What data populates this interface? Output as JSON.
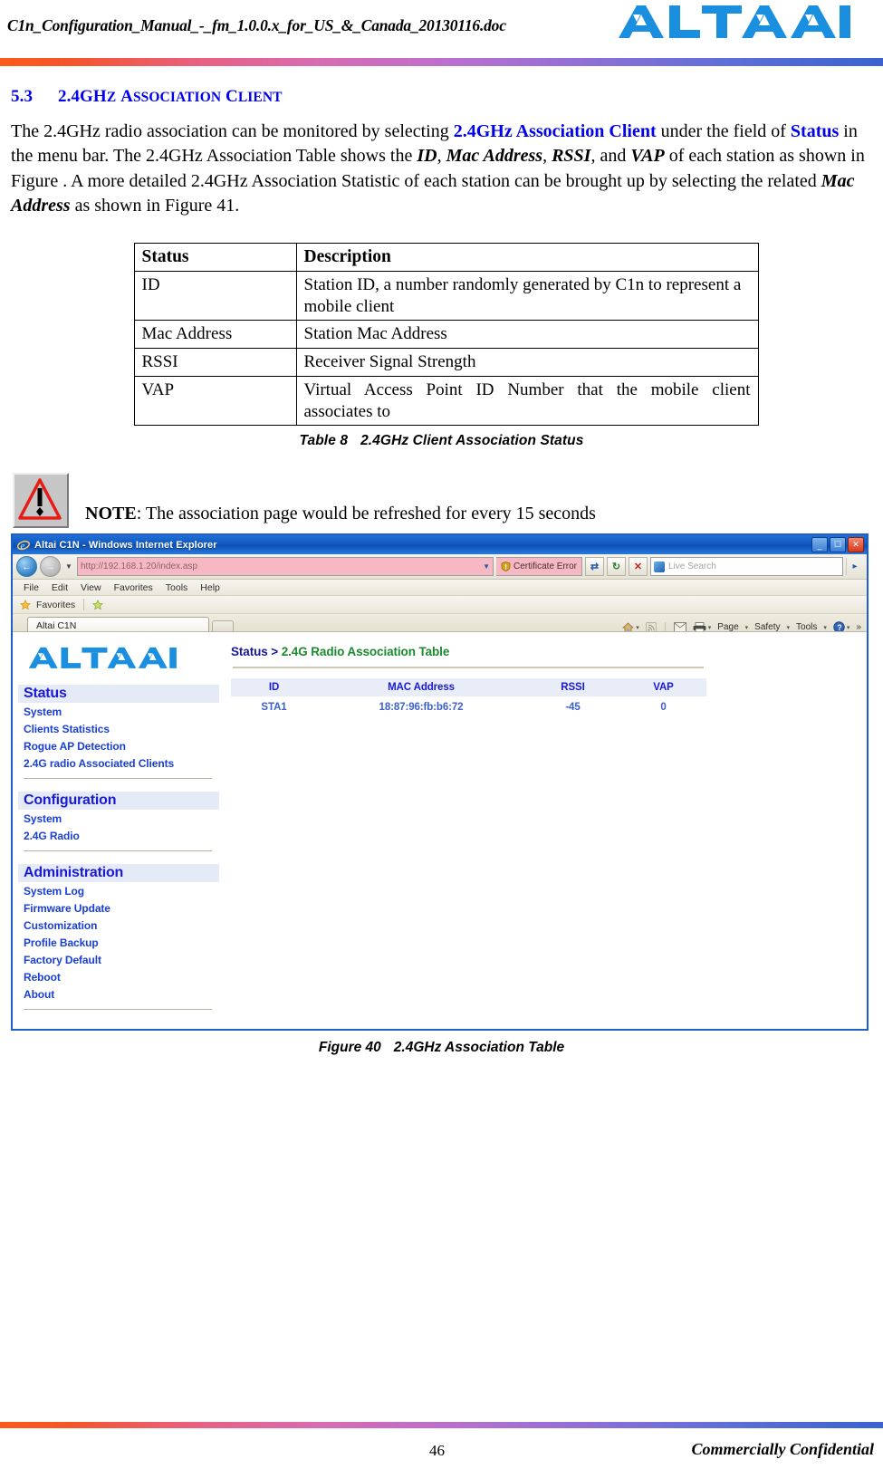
{
  "header": {
    "filename": "C1n_Configuration_Manual_-_fm_1.0.0.x_for_US_&_Canada_20130116.doc",
    "logo_alt": "ALTAI"
  },
  "section": {
    "number": "5.3",
    "title_parts": {
      "p1": "2.4GH",
      "p2": "Z",
      "p3": "A",
      "p4": "SSOCIATION",
      "p5": "C",
      "p6": "LIENT"
    },
    "title_plain": "5.3  2.4GHz Association Client"
  },
  "paragraph": {
    "t1": "The 2.4GHz radio association can be monitored by selecting ",
    "link1": "2.4GHz Association Client",
    "t2": " under the field of ",
    "link2": "Status",
    "t3": " in the menu bar. The 2.4GHz Association Table shows the ",
    "em1": "ID",
    "t4": ", ",
    "em2": "Mac Address",
    "t5": ", ",
    "em3": "RSSI",
    "t6": ", and ",
    "em4": "VAP",
    "t7": " of each station as shown in Figure . A more detailed 2.4GHz Association Statistic of each station can be brought up by selecting the related ",
    "em5": "Mac Address",
    "t8": " as shown in Figure 41."
  },
  "doc_table": {
    "headers": [
      "Status",
      "Description"
    ],
    "rows": [
      [
        "ID",
        "Station ID, a number randomly generated by C1n to represent a mobile client"
      ],
      [
        "Mac Address",
        "Station Mac Address"
      ],
      [
        "RSSI",
        "Receiver Signal Strength"
      ],
      [
        "VAP",
        "Virtual Access Point ID Number that the mobile client associates to"
      ]
    ],
    "caption_label": "Table 8",
    "caption_text": "2.4GHz Client Association Status"
  },
  "note": {
    "icon_name": "warning-triangle-icon",
    "label": "NOTE",
    "text": ": The association page would be refreshed for every 15 seconds"
  },
  "browser": {
    "window_title": "Altai C1N - Windows Internet Explorer",
    "window_buttons": {
      "minimize": "_",
      "maximize": "☐",
      "close": "✕"
    },
    "address": {
      "url_visible": "http://192.168.1.20",
      "url_faded": "/index.asp",
      "cert_error_label": "Certificate Error",
      "dropdown_caret": "▼"
    },
    "nav": {
      "back": "←",
      "forward": "→",
      "history_caret": "▼"
    },
    "toolbar_mini": {
      "refresh": "↻",
      "stop": "✕",
      "compat": "⇄"
    },
    "search": {
      "placeholder": "Live Search",
      "go": "▸"
    },
    "menu_items": [
      "File",
      "Edit",
      "View",
      "Favorites",
      "Tools",
      "Help"
    ],
    "favorites_bar": {
      "label": "Favorites"
    },
    "tab": {
      "label": "Altai C1N"
    },
    "command_bar": [
      "Page",
      "Safety",
      "Tools"
    ],
    "command_icons": [
      "home-icon",
      "feeds-icon",
      "mail-icon",
      "print-icon",
      "help-icon"
    ],
    "overflow": "»"
  },
  "webpage": {
    "logo_alt": "ALTAI",
    "breadcrumb": {
      "parent": "Status >",
      "current": "2.4G Radio Association Table"
    },
    "sidebar": [
      {
        "heading": "Status",
        "items": [
          "System",
          "Clients Statistics",
          "Rogue AP Detection",
          "2.4G radio Associated Clients"
        ]
      },
      {
        "heading": "Configuration",
        "items": [
          "System",
          "2.4G Radio"
        ]
      },
      {
        "heading": "Administration",
        "items": [
          "System Log",
          "Firmware Update",
          "Customization",
          "Profile Backup",
          "Factory Default",
          "Reboot",
          "About"
        ]
      }
    ],
    "table": {
      "headers": [
        "ID",
        "MAC Address",
        "RSSI",
        "VAP"
      ],
      "rows": [
        [
          "STA1",
          "18:87:96:fb:b6:72",
          "-45",
          "0"
        ]
      ]
    }
  },
  "figure": {
    "caption_label": "Figure 40",
    "caption_text": "2.4GHz Association Table"
  },
  "footer": {
    "page_number": "46",
    "confidential": "Commercially Confidential"
  },
  "colors": {
    "heading_blue": "#0000ee",
    "link_blue": "#0000ee",
    "web_blue": "#1a1ad6",
    "web_green": "#1a8a2e",
    "altai_blue": "#1a8fe0",
    "warn_red": "#e81c16",
    "rule_start": "#ff5a1a",
    "rule_end": "#3a62d0"
  }
}
